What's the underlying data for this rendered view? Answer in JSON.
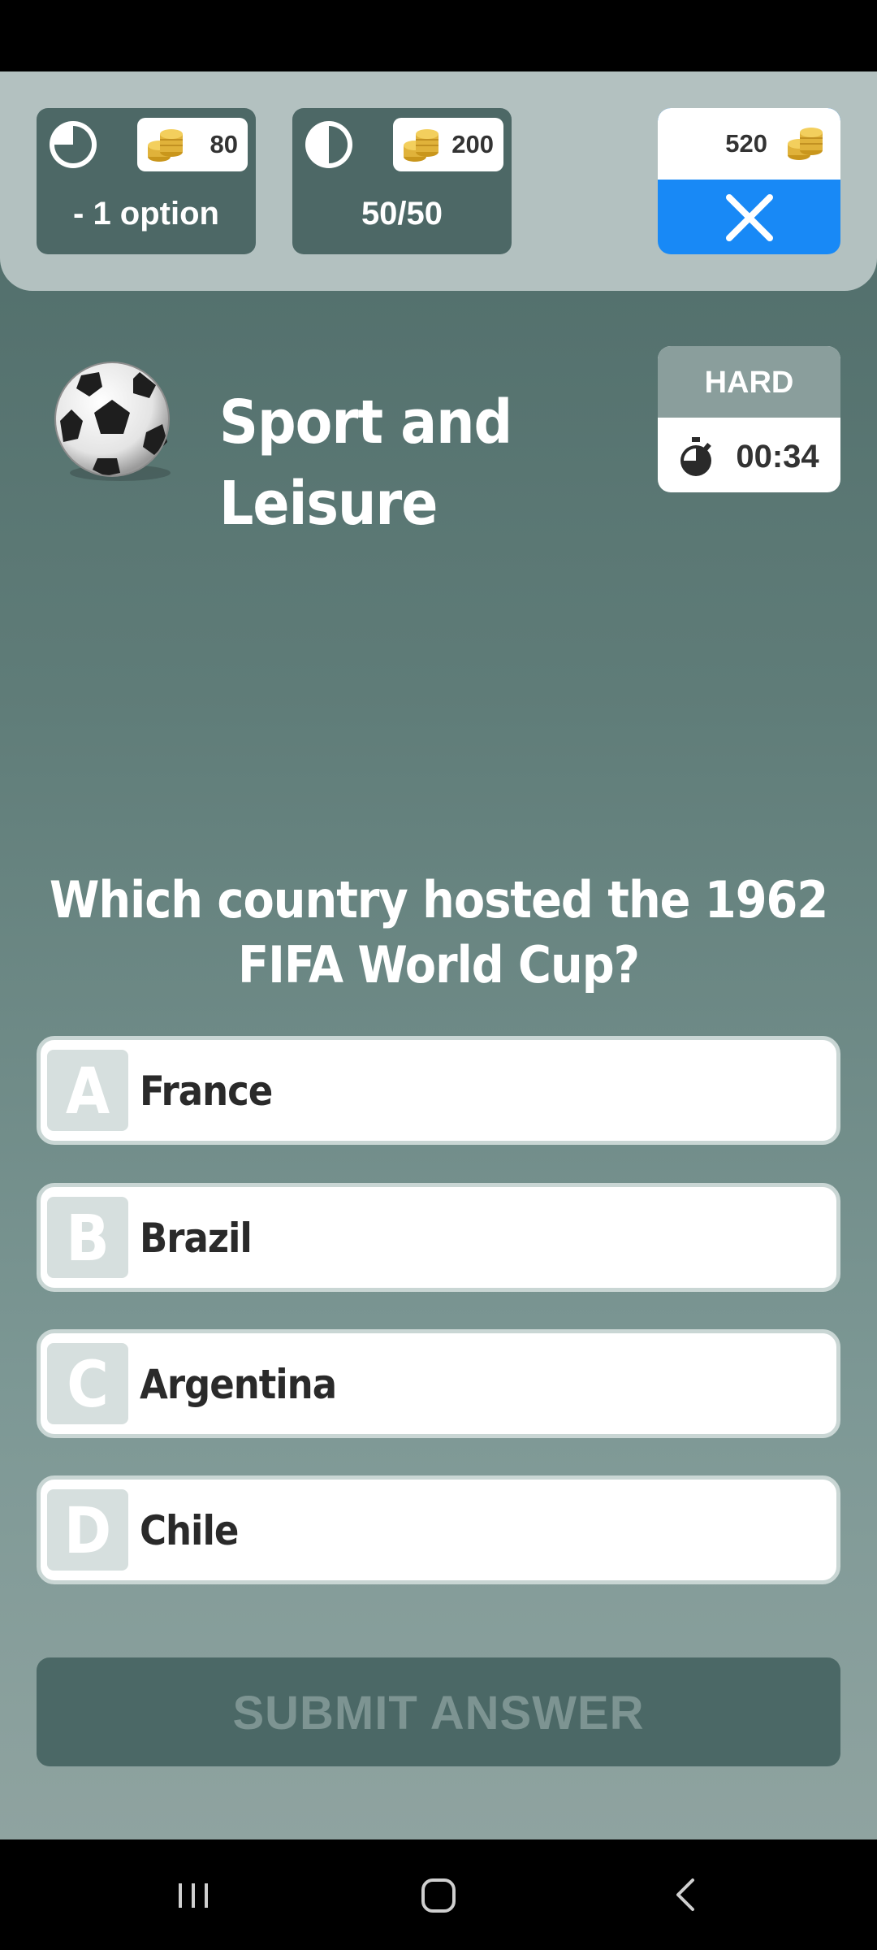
{
  "lifelines": [
    {
      "icon": "quarter-circle-icon",
      "cost": "80",
      "label": "- 1 option"
    },
    {
      "icon": "half-circle-icon",
      "cost": "200",
      "label": "50/50"
    }
  ],
  "wallet": {
    "coins": "520",
    "coin_icon": "coins-icon",
    "close_icon": "close-icon"
  },
  "category": {
    "icon": "soccer-ball-icon",
    "title": "Sport and Leisure"
  },
  "difficulty": {
    "label": "HARD",
    "timer_icon": "stopwatch-icon",
    "time_left": "00:34"
  },
  "question": {
    "text": "Which country hosted the 1962 FIFA World Cup?"
  },
  "answers": [
    {
      "letter": "A",
      "text": "France"
    },
    {
      "letter": "B",
      "text": "Brazil"
    },
    {
      "letter": "C",
      "text": "Argentina"
    },
    {
      "letter": "D",
      "text": "Chile"
    }
  ],
  "submit": {
    "label": "SUBMIT ANSWER"
  },
  "navigation": {
    "recent_icon": "recent-apps-icon",
    "home_icon": "home-icon",
    "back_icon": "back-icon"
  },
  "colors": {
    "accent": "#1889f6",
    "panel": "#4d6866",
    "top_panel": "#b3c1c0"
  }
}
